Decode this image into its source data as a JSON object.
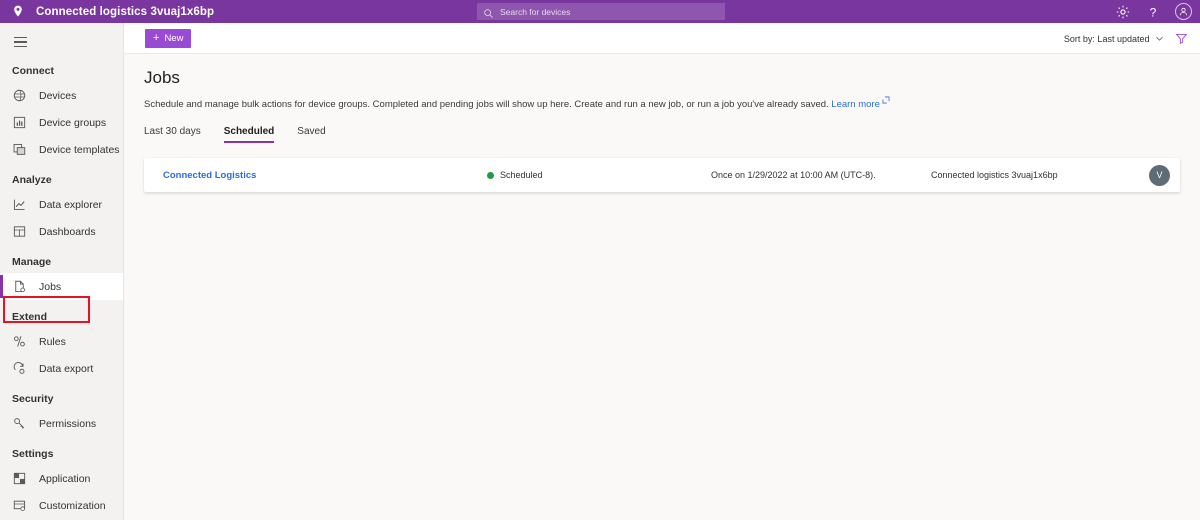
{
  "topbar": {
    "location_icon": "location-pin-icon",
    "title": "Connected logistics 3vuaj1x6bp",
    "search": {
      "placeholder": "Search for devices",
      "icon": "search-icon"
    },
    "settings_icon": "gear-icon",
    "help_icon": "help-question-icon",
    "account_icon": "account-avatar-icon",
    "brand_color": "#7a369f"
  },
  "sidebar": {
    "menu_icon": "hamburger-menu-icon",
    "groups": [
      {
        "label": "Connect",
        "items": [
          {
            "label": "Devices",
            "icon": "devices-icon",
            "selected": false
          },
          {
            "label": "Device groups",
            "icon": "device-groups-icon",
            "selected": false
          },
          {
            "label": "Device templates",
            "icon": "device-templates-icon",
            "selected": false
          }
        ]
      },
      {
        "label": "Analyze",
        "items": [
          {
            "label": "Data explorer",
            "icon": "data-explorer-icon",
            "selected": false
          },
          {
            "label": "Dashboards",
            "icon": "dashboards-icon",
            "selected": false
          }
        ]
      },
      {
        "label": "Manage",
        "items": [
          {
            "label": "Jobs",
            "icon": "jobs-icon",
            "selected": true
          }
        ]
      },
      {
        "label": "Extend",
        "items": [
          {
            "label": "Rules",
            "icon": "rules-icon",
            "selected": false
          },
          {
            "label": "Data export",
            "icon": "data-export-icon",
            "selected": false
          }
        ]
      },
      {
        "label": "Security",
        "items": [
          {
            "label": "Permissions",
            "icon": "permissions-key-icon",
            "selected": false
          }
        ]
      },
      {
        "label": "Settings",
        "items": [
          {
            "label": "Application",
            "icon": "application-icon",
            "selected": false
          },
          {
            "label": "Customization",
            "icon": "customization-icon",
            "selected": false
          }
        ]
      }
    ],
    "highlight_color": "#e81123",
    "accent_color": "#8a31a8"
  },
  "commandbar": {
    "new_label": "New",
    "new_plus": "+",
    "sort_label": "Sort by: Last updated",
    "chevron_icon": "chevron-down-icon",
    "filter_icon": "filter-funnel-icon",
    "new_button_color": "#9a4bd6"
  },
  "main": {
    "title": "Jobs",
    "description": "Schedule and manage bulk actions for device groups. Completed and pending jobs will show up here. Create and run a new job, or run a job you've already saved.",
    "learn_more": "Learn more",
    "learn_more_icon": "external-link-icon",
    "tabs": [
      {
        "label": "Last 30 days",
        "active": false
      },
      {
        "label": "Scheduled",
        "active": true
      },
      {
        "label": "Saved",
        "active": false
      }
    ],
    "jobs": [
      {
        "name": "Connected Logistics",
        "status": "Scheduled",
        "status_color": "#1d9e45",
        "schedule": "Once on 1/29/2022 at 10:00 AM (UTC-8).",
        "application": "Connected logistics 3vuaj1x6bp",
        "owner_initial": "V"
      }
    ]
  }
}
